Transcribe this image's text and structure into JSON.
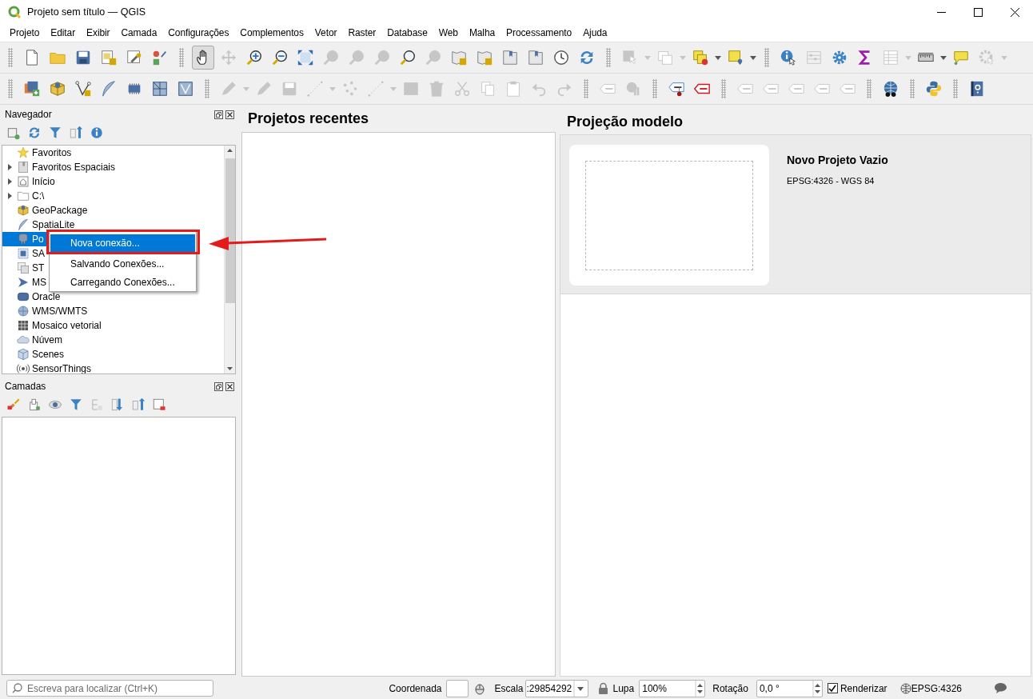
{
  "window": {
    "title": "Projeto sem título — QGIS"
  },
  "menubar": [
    {
      "label": "Projeto"
    },
    {
      "label": "Editar"
    },
    {
      "label": "Exibir"
    },
    {
      "label": "Camada"
    },
    {
      "label": "Configurações"
    },
    {
      "label": "Complementos"
    },
    {
      "label": "Vetor"
    },
    {
      "label": "Raster"
    },
    {
      "label": "Database"
    },
    {
      "label": "Web"
    },
    {
      "label": "Malha"
    },
    {
      "label": "Processamento"
    },
    {
      "label": "Ajuda"
    }
  ],
  "toolbars": [
    {
      "items": [
        {
          "kind": "separator"
        },
        {
          "kind": "button",
          "disabled": false,
          "checked": false,
          "dropdown": false
        },
        {
          "kind": "button",
          "disabled": false,
          "checked": false,
          "dropdown": false
        },
        {
          "kind": "button",
          "disabled": false,
          "checked": false,
          "dropdown": false
        },
        {
          "kind": "button",
          "disabled": false,
          "checked": false,
          "dropdown": false
        },
        {
          "kind": "button",
          "disabled": false,
          "checked": false,
          "dropdown": false
        },
        {
          "kind": "button",
          "disabled": false,
          "checked": false,
          "dropdown": false
        },
        {
          "kind": "separator"
        },
        {
          "kind": "button",
          "disabled": false,
          "checked": true,
          "dropdown": false
        },
        {
          "kind": "button",
          "disabled": true,
          "checked": false,
          "dropdown": false
        },
        {
          "kind": "button",
          "disabled": false,
          "checked": false,
          "dropdown": false
        },
        {
          "kind": "button",
          "disabled": false,
          "checked": false,
          "dropdown": false
        },
        {
          "kind": "button",
          "disabled": false,
          "checked": false,
          "dropdown": false
        },
        {
          "kind": "button",
          "disabled": true,
          "checked": false,
          "dropdown": false
        },
        {
          "kind": "button",
          "disabled": true,
          "checked": false,
          "dropdown": false
        },
        {
          "kind": "button",
          "disabled": true,
          "checked": false,
          "dropdown": false
        },
        {
          "kind": "button",
          "disabled": false,
          "checked": false,
          "dropdown": false
        },
        {
          "kind": "button",
          "disabled": true,
          "checked": false,
          "dropdown": false
        },
        {
          "kind": "button",
          "disabled": false,
          "checked": false,
          "dropdown": false
        },
        {
          "kind": "button",
          "disabled": false,
          "checked": false,
          "dropdown": false
        },
        {
          "kind": "button",
          "disabled": false,
          "checked": false,
          "dropdown": false
        },
        {
          "kind": "button",
          "disabled": false,
          "checked": false,
          "dropdown": false
        },
        {
          "kind": "button",
          "disabled": false,
          "checked": false,
          "dropdown": false
        },
        {
          "kind": "button",
          "disabled": false,
          "checked": false,
          "dropdown": false
        },
        {
          "kind": "separator"
        },
        {
          "kind": "button",
          "disabled": true,
          "checked": false,
          "dropdown": true
        },
        {
          "kind": "button",
          "disabled": true,
          "checked": false,
          "dropdown": true
        },
        {
          "kind": "button",
          "disabled": false,
          "checked": false,
          "dropdown": true
        },
        {
          "kind": "button",
          "disabled": false,
          "checked": false,
          "dropdown": true
        },
        {
          "kind": "separator"
        },
        {
          "kind": "button",
          "disabled": false,
          "checked": false,
          "dropdown": false
        },
        {
          "kind": "button",
          "disabled": true,
          "checked": false,
          "dropdown": false
        },
        {
          "kind": "button",
          "disabled": false,
          "checked": false,
          "dropdown": false
        },
        {
          "kind": "button",
          "disabled": false,
          "checked": false,
          "dropdown": false
        },
        {
          "kind": "button",
          "disabled": true,
          "checked": false,
          "dropdown": true
        },
        {
          "kind": "button",
          "disabled": false,
          "checked": false,
          "dropdown": true
        },
        {
          "kind": "button",
          "disabled": false,
          "checked": false,
          "dropdown": false
        },
        {
          "kind": "button",
          "disabled": true,
          "checked": false,
          "dropdown": true
        }
      ]
    },
    {
      "items": [
        {
          "kind": "separator"
        },
        {
          "kind": "button",
          "disabled": false,
          "checked": false,
          "dropdown": false
        },
        {
          "kind": "button",
          "disabled": false,
          "checked": false,
          "dropdown": false
        },
        {
          "kind": "button",
          "disabled": false,
          "checked": false,
          "dropdown": false
        },
        {
          "kind": "button",
          "disabled": false,
          "checked": false,
          "dropdown": false
        },
        {
          "kind": "button",
          "disabled": false,
          "checked": false,
          "dropdown": false
        },
        {
          "kind": "button",
          "disabled": false,
          "checked": false,
          "dropdown": false
        },
        {
          "kind": "button",
          "disabled": false,
          "checked": false,
          "dropdown": false
        },
        {
          "kind": "separator"
        },
        {
          "kind": "button",
          "disabled": true,
          "checked": false,
          "dropdown": true
        },
        {
          "kind": "button",
          "disabled": true,
          "checked": false,
          "dropdown": false
        },
        {
          "kind": "button",
          "disabled": true,
          "checked": false,
          "dropdown": false
        },
        {
          "kind": "button",
          "disabled": true,
          "checked": false,
          "dropdown": true
        },
        {
          "kind": "button",
          "disabled": true,
          "checked": false,
          "dropdown": false
        },
        {
          "kind": "button",
          "disabled": true,
          "checked": false,
          "dropdown": true
        },
        {
          "kind": "button",
          "disabled": true,
          "checked": false,
          "dropdown": false
        },
        {
          "kind": "button",
          "disabled": true,
          "checked": false,
          "dropdown": false
        },
        {
          "kind": "button",
          "disabled": true,
          "checked": false,
          "dropdown": false
        },
        {
          "kind": "button",
          "disabled": true,
          "checked": false,
          "dropdown": false
        },
        {
          "kind": "button",
          "disabled": true,
          "checked": false,
          "dropdown": false
        },
        {
          "kind": "button",
          "disabled": true,
          "checked": false,
          "dropdown": false
        },
        {
          "kind": "button",
          "disabled": true,
          "checked": false,
          "dropdown": false
        },
        {
          "kind": "separator"
        },
        {
          "kind": "button",
          "disabled": true,
          "checked": false,
          "dropdown": false
        },
        {
          "kind": "button",
          "disabled": true,
          "checked": false,
          "dropdown": false
        },
        {
          "kind": "separator"
        },
        {
          "kind": "button",
          "disabled": false,
          "checked": false,
          "dropdown": false
        },
        {
          "kind": "button",
          "disabled": false,
          "checked": false,
          "dropdown": false
        },
        {
          "kind": "separator"
        },
        {
          "kind": "button",
          "disabled": true,
          "checked": false,
          "dropdown": false
        },
        {
          "kind": "button",
          "disabled": true,
          "checked": false,
          "dropdown": false
        },
        {
          "kind": "button",
          "disabled": true,
          "checked": false,
          "dropdown": false
        },
        {
          "kind": "button",
          "disabled": true,
          "checked": false,
          "dropdown": false
        },
        {
          "kind": "button",
          "disabled": true,
          "checked": false,
          "dropdown": false
        },
        {
          "kind": "separator"
        },
        {
          "kind": "button",
          "disabled": false,
          "checked": false,
          "dropdown": false
        },
        {
          "kind": "separator"
        },
        {
          "kind": "button",
          "disabled": false,
          "checked": false,
          "dropdown": false
        },
        {
          "kind": "separator"
        },
        {
          "kind": "button",
          "disabled": false,
          "checked": false,
          "dropdown": false
        }
      ]
    }
  ],
  "navigator": {
    "title": "Navegador",
    "items": [
      {
        "label": "Favoritos",
        "expandable": false,
        "selected": false
      },
      {
        "label": "Favoritos Espaciais",
        "expandable": true,
        "selected": false
      },
      {
        "label": "Início",
        "expandable": true,
        "selected": false
      },
      {
        "label": "C:\\",
        "expandable": true,
        "selected": false
      },
      {
        "label": "GeoPackage",
        "expandable": false,
        "selected": false
      },
      {
        "label": "SpatiaLite",
        "expandable": false,
        "selected": false
      },
      {
        "label": "Po",
        "expandable": false,
        "selected": true
      },
      {
        "label": "SA",
        "expandable": false,
        "selected": false
      },
      {
        "label": "ST",
        "expandable": false,
        "selected": false
      },
      {
        "label": "MS",
        "expandable": false,
        "selected": false
      },
      {
        "label": "Oracle",
        "expandable": false,
        "selected": false
      },
      {
        "label": "WMS/WMTS",
        "expandable": false,
        "selected": false
      },
      {
        "label": "Mosaico vetorial",
        "expandable": false,
        "selected": false
      },
      {
        "label": "Núvem",
        "expandable": false,
        "selected": false
      },
      {
        "label": "Scenes",
        "expandable": false,
        "selected": false
      },
      {
        "label": "SensorThings",
        "expandable": false,
        "selected": false
      }
    ]
  },
  "context_menu": {
    "items": [
      {
        "label": "Nova conexão...",
        "selected": true
      },
      {
        "label": "Salvando Conexões...",
        "selected": false
      },
      {
        "label": "Carregando Conexões...",
        "selected": false
      }
    ]
  },
  "layers": {
    "title": "Camadas"
  },
  "recent_projects": {
    "title": "Projetos recentes"
  },
  "project_templates": {
    "title": "Projeção modelo",
    "templates": [
      {
        "name": "Novo Projeto Vazio",
        "crs": "EPSG:4326 - WGS 84"
      }
    ]
  },
  "status_bar": {
    "search": {
      "placeholder": "Escreva para localizar (Ctrl+K)"
    },
    "coordinate_label": "Coordenada",
    "scale_label": "Escala",
    "scale_value": ":29854292",
    "magnifier_label": "Lupa",
    "magnifier_value": "100%",
    "rotation_label": "Rotação",
    "rotation_value": "0,0 °",
    "render": {
      "label": "Renderizar",
      "checked": true
    },
    "crs": "EPSG:4326"
  }
}
